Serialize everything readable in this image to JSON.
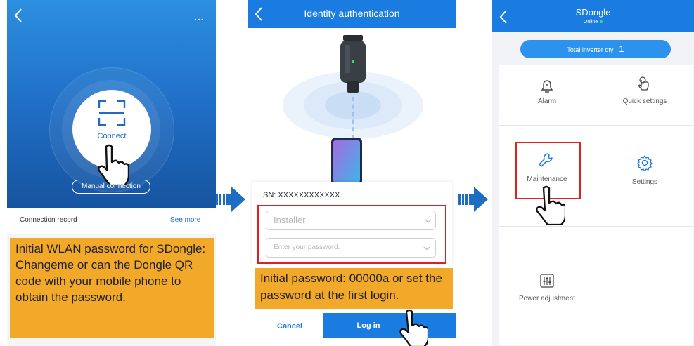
{
  "panel1": {
    "connect_label": "Connect",
    "manual_connection": "Manual connection",
    "more": "...",
    "connection_record": "Connection record",
    "see_more": "See more",
    "note": "Initial WLAN password for SDongle: Changeme or can the Dongle QR code with your mobile phone to obtain the password."
  },
  "panel2": {
    "title": "Identity authentication",
    "sn": "SN: XXXXXXXXXXXX",
    "user_field": "Installer",
    "password_placeholder": "Enter your password.",
    "note": "Initial password: 00000a or set the password at the first login.",
    "cancel": "Cancel",
    "login": "Log in"
  },
  "panel3": {
    "title": "SDongle",
    "status": "Online",
    "total_label": "Total inverter qty",
    "total_value": "1",
    "tiles": {
      "alarm": "Alarm",
      "quick_settings": "Quick settings",
      "maintenance": "Maintenance",
      "settings": "Settings",
      "power_adjustment": "Power adjustment"
    }
  },
  "colors": {
    "accent": "#1a7be0",
    "note_bg": "#f2a92a",
    "highlight": "#e02020"
  },
  "icons": [
    "back-icon",
    "scan-icon",
    "hand-pointer-icon",
    "arrow-right-icon",
    "chevron-down-icon",
    "alarm-icon",
    "touch-icon",
    "wrench-icon",
    "gear-icon",
    "sliders-icon"
  ]
}
